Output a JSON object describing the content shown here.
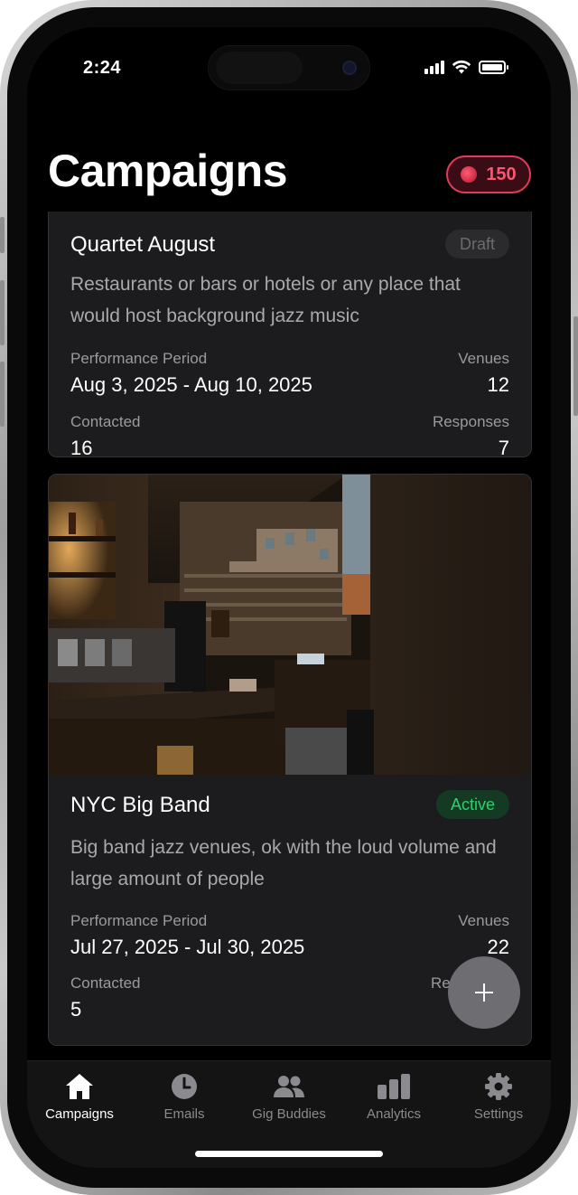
{
  "status_bar": {
    "time": "2:24"
  },
  "header": {
    "title": "Campaigns",
    "credits": "150"
  },
  "campaigns": [
    {
      "title": "Quartet August",
      "status": "Draft",
      "description": "Restaurants or bars or hotels or any place that would host background jazz music",
      "period_label": "Performance Period",
      "period": "Aug 3, 2025 - Aug 10, 2025",
      "venues_label": "Venues",
      "venues": "12",
      "contacted_label": "Contacted",
      "contacted": "16",
      "responses_label": "Responses",
      "responses": "7"
    },
    {
      "title": "NYC Big Band",
      "status": "Active",
      "description": "Big band jazz venues, ok with the loud volume and large amount of people",
      "period_label": "Performance Period",
      "period": "Jul 27, 2025 - Jul 30, 2025",
      "venues_label": "Venues",
      "venues": "22",
      "contacted_label": "Contacted",
      "contacted": "5",
      "responses_label": "Re"
    }
  ],
  "tabs": [
    {
      "label": "Campaigns",
      "icon": "home-icon",
      "active": true
    },
    {
      "label": "Emails",
      "icon": "clock-icon",
      "active": false
    },
    {
      "label": "Gig Buddies",
      "icon": "people-icon",
      "active": false
    },
    {
      "label": "Analytics",
      "icon": "bar-chart-icon",
      "active": false
    },
    {
      "label": "Settings",
      "icon": "gear-icon",
      "active": false
    }
  ],
  "colors": {
    "background": "#000000",
    "card": "#1c1c1e",
    "credits_accent": "#ff5470",
    "active_green": "#2fcf6a",
    "draft_gray": "#6b6b70"
  }
}
